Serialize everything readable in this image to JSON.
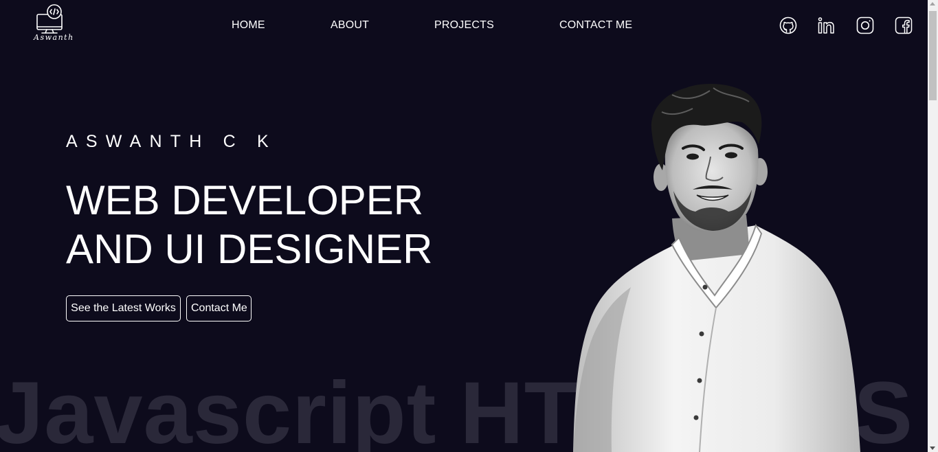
{
  "logo": {
    "text": "Aswanth",
    "icon": "computer-code-icon"
  },
  "nav": {
    "items": [
      {
        "label": "HOME"
      },
      {
        "label": "ABOUT"
      },
      {
        "label": "PROJECTS"
      },
      {
        "label": "CONTACT ME"
      }
    ]
  },
  "social": [
    {
      "icon": "github-icon"
    },
    {
      "icon": "linkedin-icon"
    },
    {
      "icon": "instagram-icon"
    },
    {
      "icon": "facebook-icon"
    }
  ],
  "hero": {
    "name": "ASWANTH C K",
    "headline_line1": "WEB DEVELOPER",
    "headline_line2": "AND UI DESIGNER",
    "primary_button": "See the Latest Works",
    "secondary_button": "Contact Me"
  },
  "skills": [
    "Javascript",
    "HTML",
    "CSS"
  ],
  "colors": {
    "background": "#0d0b1c",
    "text": "#ffffff",
    "marquee_text": "#2a2839"
  }
}
